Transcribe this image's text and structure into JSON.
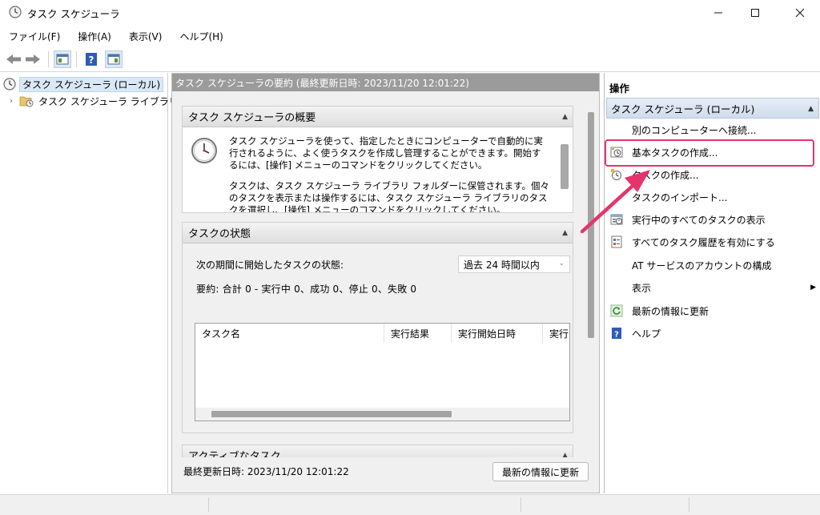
{
  "window": {
    "title": "タスク スケジューラ"
  },
  "menu": [
    "ファイル(F)",
    "操作(A)",
    "表示(V)",
    "ヘルプ(H)"
  ],
  "tree": {
    "root": "タスク スケジューラ (ローカル)",
    "child": "タスク スケジューラ ライブラリ"
  },
  "center": {
    "header": "タスク スケジューラの要約 (最終更新日時: 2023/11/20 12:01:22)",
    "overview": {
      "title": "タスク スケジューラの概要",
      "para1": "タスク スケジューラを使って、指定したときにコンピューターで自動的に実行されるように、よく使うタスクを作成し管理することができます。開始するには、[操作] メニューのコマンドをクリックしてください。",
      "para2": "タスクは、タスク スケジューラ ライブラリ フォルダーに保管されます。個々のタスクを表示または操作するには、タスク スケジューラ ライブラリのタスクを選択し、[操作] メニューのコマンドをクリックしてください。"
    },
    "status": {
      "title": "タスクの状態",
      "period_label": "次の期間に開始したタスクの状態:",
      "period_value": "過去 24 時間以内",
      "summary": "要約: 合計 0 - 実行中 0、成功 0、停止 0、失敗 0",
      "columns": [
        "タスク名",
        "実行結果",
        "実行開始日時",
        "実行"
      ]
    },
    "active": {
      "title": "アクティブなタスク"
    },
    "footer_label": "最終更新日時: 2023/11/20 12:01:22",
    "refresh_button": "最新の情報に更新"
  },
  "actions": {
    "title": "操作",
    "section": "タスク スケジューラ (ローカル)",
    "items": [
      {
        "label": "別のコンピューターへ接続...",
        "icon": "none"
      },
      {
        "label": "基本タスクの作成...",
        "icon": "basic-task-icon"
      },
      {
        "label": "タスクの作成...",
        "icon": "create-task-icon"
      },
      {
        "label": "タスクのインポート...",
        "icon": "none"
      },
      {
        "label": "実行中のすべてのタスクの表示",
        "icon": "running-tasks-icon"
      },
      {
        "label": "すべてのタスク履歴を有効にする",
        "icon": "history-icon"
      },
      {
        "label": "AT サービスのアカウントの構成",
        "icon": "none"
      },
      {
        "label": "表示",
        "icon": "none"
      },
      {
        "label": "最新の情報に更新",
        "icon": "refresh-icon"
      },
      {
        "label": "ヘルプ",
        "icon": "help-icon"
      }
    ]
  },
  "colors": {
    "highlight": "#e5346b",
    "header_gray": "#9b9b9b"
  }
}
